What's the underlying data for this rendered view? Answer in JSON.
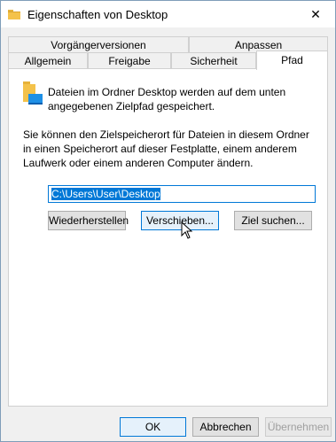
{
  "window": {
    "title": "Eigenschaften von Desktop",
    "close_glyph": "✕"
  },
  "tabs": {
    "row1": [
      "Vorgängerversionen",
      "Anpassen"
    ],
    "row2": [
      "Allgemein",
      "Freigabe",
      "Sicherheit",
      "Pfad"
    ],
    "active": "Pfad"
  },
  "panel": {
    "intro": "Dateien im Ordner Desktop werden auf dem unten angegebenen Zielpfad gespeichert.",
    "description": "Sie können den Zielspeicherort für Dateien in diesem Ordner in einen Speicherort auf dieser Festplatte, einem anderem Laufwerk oder einem anderen Computer ändern.",
    "path_value": "C:\\Users\\User\\Desktop",
    "buttons": {
      "restore": "Wiederherstellen",
      "move": "Verschieben...",
      "find_target": "Ziel suchen..."
    }
  },
  "footer": {
    "ok": "OK",
    "cancel": "Abbrechen",
    "apply": "Übernehmen"
  },
  "colors": {
    "accent": "#0078d7",
    "folder_yellow": "#f4c24a",
    "folder_blue": "#1e90e6"
  }
}
